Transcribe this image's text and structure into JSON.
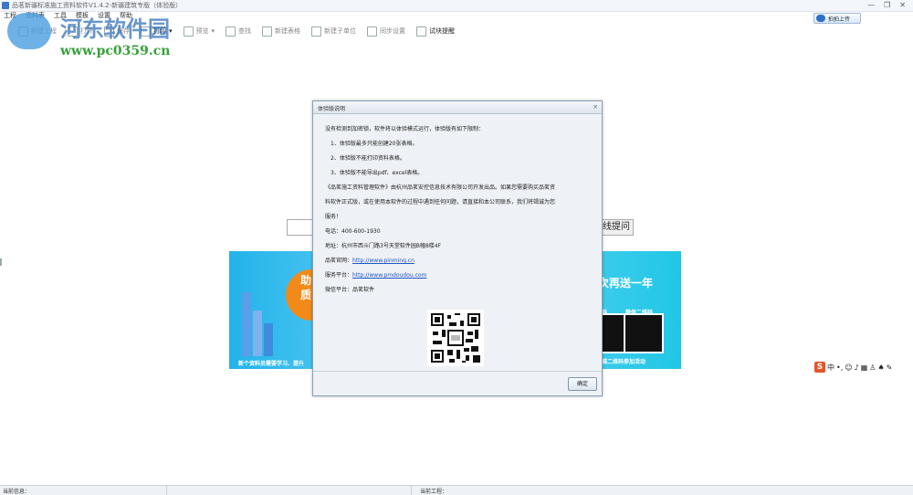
{
  "window": {
    "title": "品茗新疆标准施工资料软件V1.4.2-新疆建筑专版（体验版）",
    "controls": [
      "—",
      "❐",
      "✕"
    ]
  },
  "menu": [
    "工程",
    "资料表",
    "工具",
    "模板",
    "设置",
    "帮助"
  ],
  "toolbar": {
    "items": [
      "新建工程",
      "打开",
      "保存",
      "打印",
      "预览",
      "查找",
      "新建表格",
      "新建子单位",
      "同步设置",
      "试块提醒"
    ]
  },
  "upload_button": {
    "label": "拍拍上传"
  },
  "watermark": {
    "text": "河东软件园",
    "url": "www.pc0359.cn"
  },
  "ask_button": {
    "label": "线提问"
  },
  "banner": {
    "left_circle_text": "助\n质",
    "left_caption": "新个资料员需要学习、提升",
    "right_title": "次再送一年",
    "qr_label_1": "码",
    "qr_label_2": "微信二维码",
    "right_caption": "描二维码参加活动"
  },
  "dialog": {
    "title": "体验版说明",
    "close_icon": "×",
    "intro": "没有检测到加密锁，软件将以体验模式运行，体验版有如下限制：",
    "limits": [
      "1、体验版最多只能创建20张表格。",
      "2、体验版不能打印资料表格。",
      "3、体验版不能导出pdf、excel表格。"
    ],
    "para1": "《品茗施工资料管理软件》由杭州品茗安控信息技术有限公司开发出品。如果您需要购买品茗资",
    "para2": "料软件正式版，或在使用本软件的过程中遇到任何问题，请直接和本公司联系，我们将竭诚为您",
    "para3": "服务！",
    "phone_label": "电话：",
    "phone": "400-600-1930",
    "address_label": "地址：",
    "address": "杭州市西斗门路3号天堂软件园B幢8楼4F",
    "site_label": "品茗官网：",
    "site": "http://www.pinming.cn",
    "service_label": "服务平台：",
    "service": "http://www.pmdoudou.com",
    "wechat_label": "微信平台：",
    "wechat": "品茗软件",
    "ok_label": "确定"
  },
  "ime_bar": {
    "logo": "S",
    "mode": "中"
  },
  "status": {
    "left": "当前信息：",
    "right": "当前工程："
  }
}
